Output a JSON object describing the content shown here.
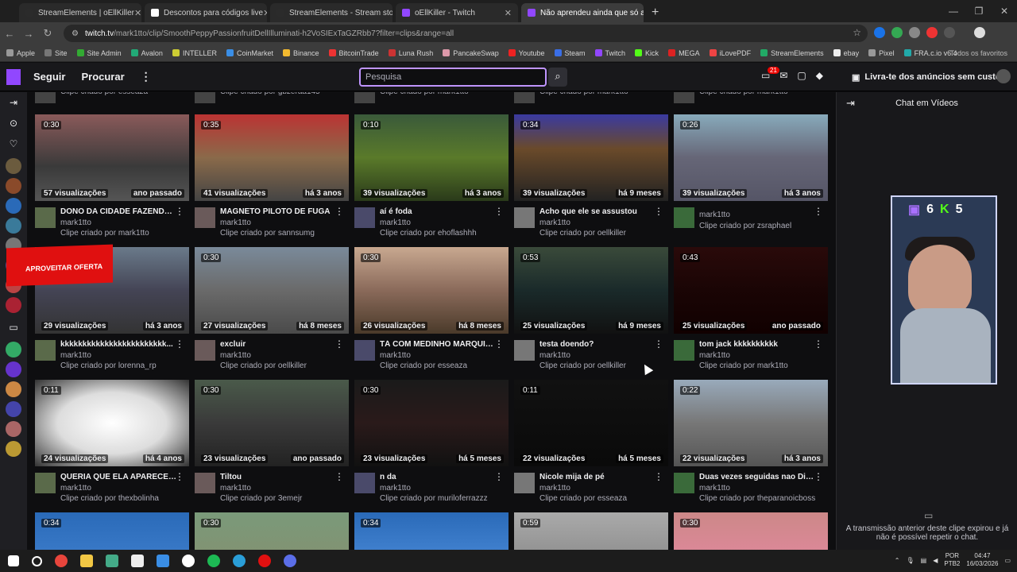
{
  "browser": {
    "tabs": [
      {
        "label": "StreamElements | oEllKiller",
        "color": "#2b2b2b"
      },
      {
        "label": "Descontos para códigos live",
        "color": "#ffffff"
      },
      {
        "label": "StreamElements - Stream store",
        "color": "#2b2b2b"
      },
      {
        "label": "oEllKiller - Twitch",
        "color": "#9147ff"
      },
      {
        "label": "Não aprendeu ainda que só ac...",
        "color": "#9147ff"
      }
    ],
    "url_host": "twitch.tv",
    "url_path": "/mark1tto/clip/SmoothPeppyPassionfruitDellIlluminati-h2VoSIExTaGZRbb7?filter=clips&range=all",
    "bookmarks": [
      "Apple",
      "Site",
      "Site Admin",
      "Avalon",
      "INTELLER",
      "CoinMarket",
      "Binance",
      "BitcoinTrade",
      "Luna Rush",
      "PancakeSwap",
      "Youtube",
      "Steam",
      "Twitch",
      "Kick",
      "MEGA",
      "iLovePDF",
      "StreamElements",
      "ebay",
      "Pixel",
      "FRA.c.io v6.4"
    ],
    "bookmarks_right": "Todos os favoritos"
  },
  "twitch": {
    "nav": [
      "Seguir",
      "Procurar"
    ],
    "search_placeholder": "Pesquisa",
    "notif_count": "21",
    "promo": "Livra-te dos anúncios sem custos"
  },
  "overlay_tag": "APROVEITAR OFERTA",
  "top_partial": [
    {
      "by": "Clipe criado por esseaza"
    },
    {
      "by": "Clipe criado por gbzeraa145"
    },
    {
      "by": "Clipe criado por mark1tto"
    },
    {
      "by": "Clipe criado por mark1tto"
    },
    {
      "by": "Clipe criado por mark1tto"
    }
  ],
  "clips": [
    {
      "dur": "0:30",
      "views": "57 visualizações",
      "age": "ano passado",
      "title": "DONO DA CIDADE FAZENDO O...",
      "chan": "mark1tto",
      "by": "Clipe criado por mark1tto"
    },
    {
      "dur": "0:35",
      "views": "41 visualizações",
      "age": "há 3 anos",
      "title": "MAGNETO PILOTO DE FUGA",
      "chan": "mark1tto",
      "by": "Clipe criado por sannsumg"
    },
    {
      "dur": "0:10",
      "views": "39 visualizações",
      "age": "há 3 anos",
      "title": "aí é foda",
      "chan": "mark1tto",
      "by": "Clipe criado por ehoflashhh"
    },
    {
      "dur": "0:34",
      "views": "39 visualizações",
      "age": "há 9 meses",
      "title": "Acho que ele se assustou",
      "chan": "mark1tto",
      "by": "Clipe criado por oellkiller"
    },
    {
      "dur": "0:26",
      "views": "39 visualizações",
      "age": "há 3 anos",
      "title": "",
      "chan": "mark1tto",
      "by": "Clipe criado por zsraphael"
    },
    {
      "dur": "",
      "views": "29 visualizações",
      "age": "há 3 anos",
      "title": "kkkkkkkkkkkkkkkkkkkkkkkk...",
      "chan": "mark1tto",
      "by": "Clipe criado por lorenna_rp"
    },
    {
      "dur": "0:30",
      "views": "27 visualizações",
      "age": "há 8 meses",
      "title": "excluir",
      "chan": "mark1tto",
      "by": "Clipe criado por oellkiller"
    },
    {
      "dur": "0:30",
      "views": "26 visualizações",
      "age": "há 8 meses",
      "title": "TÁ COM MEDINHO MARQUITO?",
      "chan": "mark1tto",
      "by": "Clipe criado por esseaza"
    },
    {
      "dur": "0:53",
      "views": "25 visualizações",
      "age": "há 9 meses",
      "title": "testa doendo?",
      "chan": "mark1tto",
      "by": "Clipe criado por oellkiller"
    },
    {
      "dur": "0:43",
      "views": "25 visualizações",
      "age": "ano passado",
      "title": "tom jack kkkkkkkkkk",
      "chan": "mark1tto",
      "by": "Clipe criado por mark1tto"
    },
    {
      "dur": "0:11",
      "views": "24 visualizações",
      "age": "há 4 anos",
      "title": "QUERIA QUE ELA APARECESS...",
      "chan": "mark1tto",
      "by": "Clipe criado por thexbolinha"
    },
    {
      "dur": "0:30",
      "views": "23 visualizações",
      "age": "ano passado",
      "title": "Tiltou",
      "chan": "mark1tto",
      "by": "Clipe criado por 3emejr"
    },
    {
      "dur": "0:30",
      "views": "23 visualizações",
      "age": "há 5 meses",
      "title": "n da",
      "chan": "mark1tto",
      "by": "Clipe criado por muriloferrazzz"
    },
    {
      "dur": "0:11",
      "views": "22 visualizações",
      "age": "há 5 meses",
      "title": "Nicole mija de pé",
      "chan": "mark1tto",
      "by": "Clipe criado por esseaza"
    },
    {
      "dur": "0:22",
      "views": "22 visualizações",
      "age": "há 3 anos",
      "title": "Duas vezes seguidas nao DigD...",
      "chan": "mark1tto",
      "by": "Clipe criado por theparanoicboss"
    },
    {
      "dur": "0:34",
      "views": "",
      "age": "",
      "title": "",
      "chan": "",
      "by": ""
    },
    {
      "dur": "0:30",
      "views": "",
      "age": "",
      "title": "",
      "chan": "",
      "by": ""
    },
    {
      "dur": "0:34",
      "views": "",
      "age": "",
      "title": "",
      "chan": "",
      "by": ""
    },
    {
      "dur": "0:59",
      "views": "",
      "age": "",
      "title": "",
      "chan": "",
      "by": ""
    },
    {
      "dur": "0:30",
      "views": "",
      "age": "",
      "title": "",
      "chan": "",
      "by": ""
    }
  ],
  "chat": {
    "title": "Chat em Vídeos",
    "message": "A transmissão anterior deste clipe expirou e já não é possível repetir o chat.",
    "twitch_count": "6",
    "kick_count": "5"
  },
  "taskbar": {
    "lang": "POR",
    "layout": "PTB2",
    "time": "04:47",
    "date": "16/03/2026"
  }
}
